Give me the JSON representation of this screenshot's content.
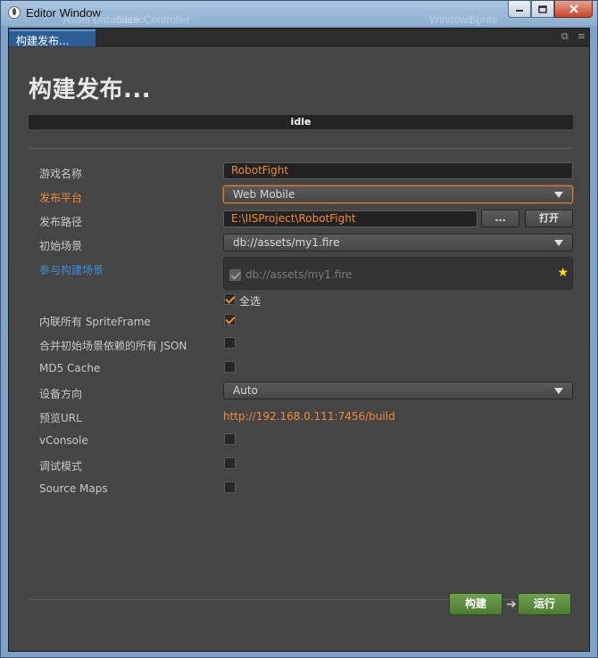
{
  "window": {
    "title": "Editor Window",
    "ghost_texts": [
      "Asset Database",
      "SanicController",
      "Windows ",
      "Sprite"
    ]
  },
  "tab": {
    "label": "构建发布..."
  },
  "panel": {
    "title": "构建发布...",
    "status": "idle"
  },
  "labels": {
    "game_name": "游戏名称",
    "platform": "发布平台",
    "build_path": "发布路径",
    "start_scene": "初始场景",
    "included_scenes": "参与构建场景",
    "inline_spriteframe": "内联所有 SpriteFrame",
    "merge_json": "合并初始场景依赖的所有 JSON",
    "md5_cache": "MD5 Cache",
    "orientation": "设备方向",
    "preview_url": "预览URL",
    "vconsole": "vConsole",
    "debug": "调试模式",
    "source_maps": "Source Maps"
  },
  "values": {
    "game_name": "RobotFight",
    "platform": "Web Mobile",
    "build_path": "E:\\IISProject\\RobotFight",
    "start_scene": "db://assets/my1.fire",
    "scene_item": "db://assets/my1.fire",
    "select_all": "全选",
    "orientation": "Auto",
    "preview_url": "http://192.168.0.111:7456/build"
  },
  "buttons": {
    "browse": "...",
    "open": "打开",
    "build": "构建",
    "run": "运行"
  },
  "checkboxes": {
    "scene_item": true,
    "select_all": true,
    "inline_spriteframe": true,
    "merge_json": false,
    "md5_cache": false,
    "vconsole": false,
    "debug": false,
    "source_maps": false
  },
  "icons": {
    "app": "cocos-app-icon",
    "minimize": "minimize-icon",
    "maximize": "maximize-icon",
    "close": "close-icon",
    "popout": "popout-icon",
    "menu": "menu-icon",
    "star": "star-icon",
    "caret": "chevron-down-icon",
    "arrow": "arrow-right-icon"
  },
  "colors": {
    "accent_orange": "#f08a3a",
    "link_blue": "#3a8fd8",
    "build_green": "#5d8e3f",
    "star_yellow": "#ffe000",
    "tab_blue": "#2d5d95"
  }
}
